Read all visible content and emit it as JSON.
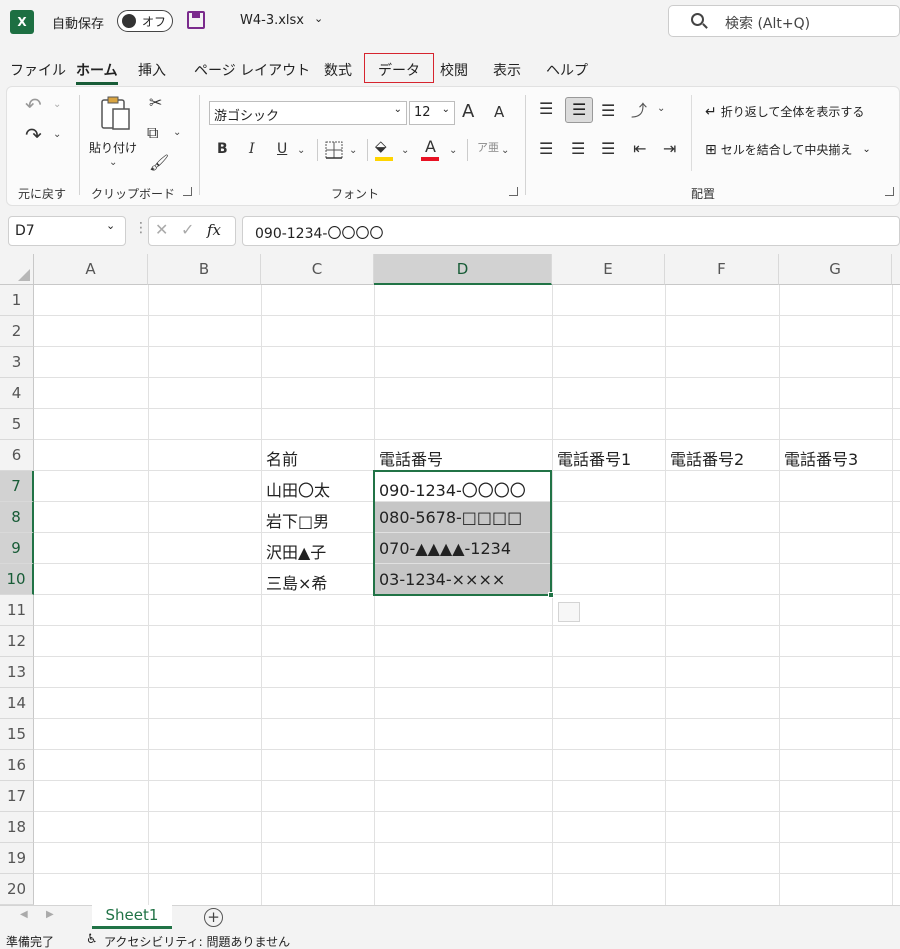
{
  "titlebar": {
    "app_logo": "X",
    "autosave_label": "自動保存",
    "autosave_state": "オフ",
    "filename": "W4-3.xlsx",
    "search_placeholder": "検索 (Alt+Q)"
  },
  "menu": {
    "tabs": [
      "ファイル",
      "ホーム",
      "挿入",
      "ページ レイアウト",
      "数式",
      "データ",
      "校閲",
      "表示",
      "ヘルプ"
    ],
    "active": "ホーム",
    "highlighted": "データ",
    "highlight_color": "#d6242e"
  },
  "ribbon": {
    "undo_group_label": "元に戻す",
    "clipboard": {
      "paste_label": "貼り付け",
      "group_label": "クリップボード"
    },
    "font": {
      "font_name": "游ゴシック",
      "font_size": "12",
      "bold": "B",
      "italic": "I",
      "underline": "U",
      "increase": "A",
      "decrease": "A",
      "font_color": "A",
      "font_color_value": "#e81123",
      "fill_color_value": "#ffd400",
      "group_label": "フォント"
    },
    "alignment": {
      "wrap_text": "折り返して全体を表示する",
      "merge_center": "セルを結合して中央揃え",
      "group_label": "配置"
    }
  },
  "formula_bar": {
    "name_box": "D7",
    "fx": "fx",
    "value": "090-1234-〇〇〇〇"
  },
  "grid": {
    "columns": [
      "A",
      "B",
      "C",
      "D",
      "E",
      "F",
      "G"
    ],
    "selected_column": "D",
    "rows": [
      "1",
      "2",
      "3",
      "4",
      "5",
      "6",
      "7",
      "8",
      "9",
      "10",
      "11",
      "12",
      "13",
      "14",
      "15",
      "16",
      "17",
      "18",
      "19",
      "20"
    ],
    "selected_rows": [
      "7",
      "8",
      "9",
      "10"
    ],
    "header_row": {
      "c": "名前",
      "d": "電話番号",
      "e": "電話番号1",
      "f": "電話番号2",
      "g": "電話番号3"
    },
    "data_rows": [
      {
        "name": "山田〇太",
        "phone": "090-1234-〇〇〇〇"
      },
      {
        "name": "岩下□男",
        "phone": "080-5678-□□□□"
      },
      {
        "name": "沢田▲子",
        "phone": "070-▲▲▲▲-1234"
      },
      {
        "name": "三島×希",
        "phone": "03-1234-××××"
      }
    ],
    "accent_color": "#217346"
  },
  "sheets": {
    "tabs": [
      "Sheet1"
    ],
    "add_label": "+"
  },
  "status": {
    "ready": "準備完了",
    "accessibility": "アクセシビリティ: 問題ありません"
  }
}
